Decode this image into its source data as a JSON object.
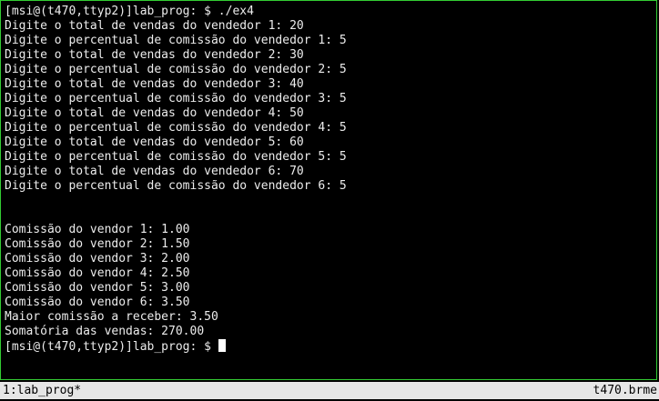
{
  "terminal": {
    "lines": [
      "[msi@(t470,ttyp2)]lab_prog: $ ./ex4",
      "Digite o total de vendas do vendedor 1: 20",
      "Digite o percentual de comissão do vendedor 1: 5",
      "Digite o total de vendas do vendedor 2: 30",
      "Digite o percentual de comissão do vendedor 2: 5",
      "Digite o total de vendas do vendedor 3: 40",
      "Digite o percentual de comissão do vendedor 3: 5",
      "Digite o total de vendas do vendedor 4: 50",
      "Digite o percentual de comissão do vendedor 4: 5",
      "Digite o total de vendas do vendedor 5: 60",
      "Digite o percentual de comissão do vendedor 5: 5",
      "Digite o total de vendas do vendedor 6: 70",
      "Digite o percentual de comissão do vendedor 6: 5",
      "",
      "",
      "Comissão do vendor 1: 1.00",
      "Comissão do vendor 2: 1.50",
      "Comissão do vendor 3: 2.00",
      "Comissão do vendor 4: 2.50",
      "Comissão do vendor 5: 3.00",
      "Comissão do vendor 6: 3.50",
      "Maior comissão a receber: 3.50",
      "Somatória das vendas: 270.00"
    ],
    "prompt": "[msi@(t470,ttyp2)]lab_prog: $ "
  },
  "statusbar": {
    "left": "1:lab_prog*",
    "right": "t470.brme"
  },
  "colors": {
    "background": "#000000",
    "text": "#ececec",
    "border": "#33cc33",
    "statusbar_bg": "#e6e6e6"
  }
}
